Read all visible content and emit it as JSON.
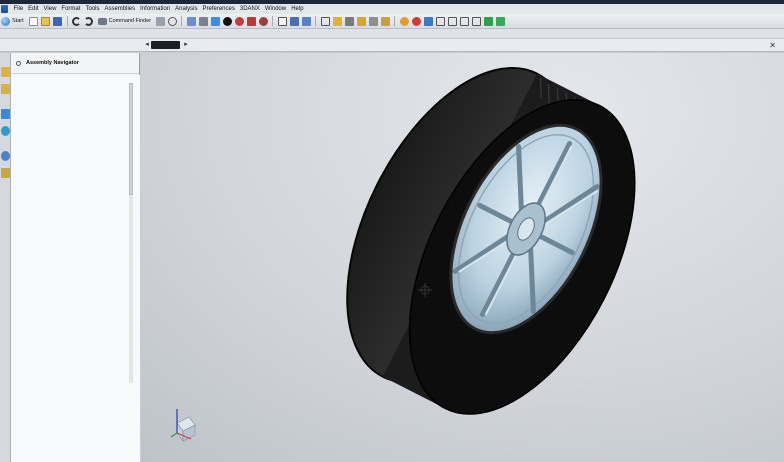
{
  "menubar": {
    "items": [
      "File",
      "Edit",
      "View",
      "Format",
      "Tools",
      "Assemblies",
      "Information",
      "Analysis",
      "Preferences",
      "3DANX",
      "Window",
      "Help"
    ]
  },
  "toolbar": {
    "start_label": "Start",
    "command_finder_label": "Command Finder"
  },
  "navigator": {
    "title": "Assembly Navigator"
  },
  "colors": {
    "title_bar": "#1c2838",
    "tire": "#121212",
    "rim": "#bcd3e2",
    "background": "#d0d4d9"
  },
  "icons": {
    "resource_bar": [
      "assembly-navigator-icon",
      "constraint-navigator-icon",
      "part-navigator-icon",
      "reuse-library-icon",
      "history-icon",
      "system-materials-icon"
    ],
    "view_triad": "view-triad-icon"
  }
}
